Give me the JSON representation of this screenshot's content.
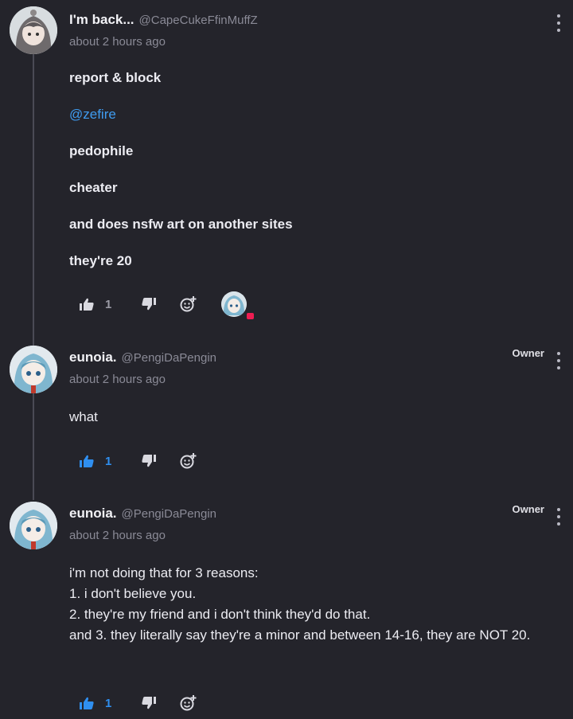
{
  "comments": [
    {
      "display_name": "I'm back...",
      "handle": "@CapeCukeFfinMuffZ",
      "time": "about 2 hours ago",
      "badge": "",
      "lines": [
        "report & block",
        "@zefire",
        "pedophile",
        "cheater",
        "and does nsfw art on another sites",
        "they're 20"
      ],
      "likes": "1",
      "liked": false,
      "avatar_icon": "gray-haired-anime-avatar"
    },
    {
      "display_name": "eunoia.",
      "handle": "@PengiDaPengin",
      "time": "about 2 hours ago",
      "badge": "Owner",
      "lines": [
        "what"
      ],
      "likes": "1",
      "liked": true,
      "avatar_icon": "blue-haired-anime-avatar"
    },
    {
      "display_name": "eunoia.",
      "handle": "@PengiDaPengin",
      "time": "about 2 hours ago",
      "badge": "Owner",
      "lines": [
        "i'm not doing that for 3 reasons:",
        "1. i don't believe you.",
        "2. they're my friend and i don't think they'd do that.",
        "and 3. they literally say they're a minor and between 14-16, they are NOT 20."
      ],
      "likes": "1",
      "liked": true,
      "avatar_icon": "blue-haired-anime-avatar"
    }
  ],
  "icons": {
    "like": "thumbs-up-icon",
    "dislike": "thumbs-down-icon",
    "react": "add-reaction-icon",
    "menu": "kebab-menu-icon"
  },
  "colors": {
    "background": "#24242b",
    "accent": "#2f8ff0",
    "mention": "#3f9cf0",
    "muted": "#8a8a96",
    "notification": "#ee1d52"
  }
}
